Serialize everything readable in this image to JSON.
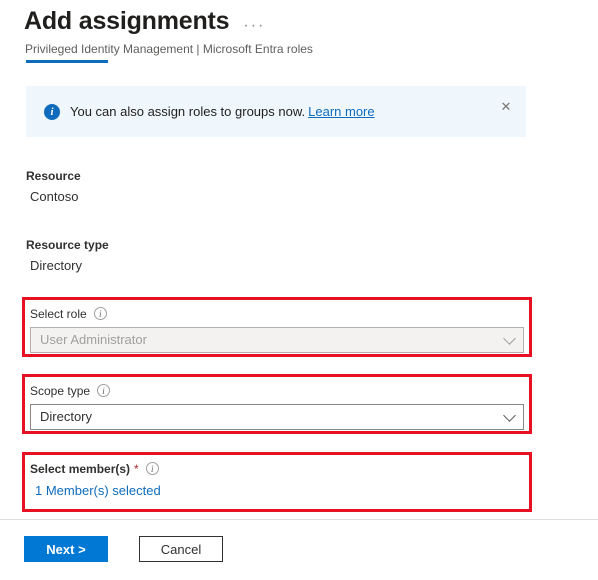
{
  "header": {
    "title": "Add assignments",
    "more_label": "···",
    "subtitle": "Privileged Identity Management | Microsoft Entra roles"
  },
  "banner": {
    "icon": "info-icon",
    "message": "You can also assign roles to groups now.",
    "link_label": "Learn more",
    "close_label": "✕",
    "background_color": "#EFF6FC",
    "accent_color": "#0F6CBD"
  },
  "resource": {
    "label": "Resource",
    "value": "Contoso"
  },
  "resource_type": {
    "label": "Resource type",
    "value": "Directory"
  },
  "select_role": {
    "label": "Select role",
    "hint_icon": "info-circle-icon",
    "value": "User Administrator",
    "disabled": true,
    "chevron_icon": "chevron-down-icon",
    "highlighted": true
  },
  "scope_type": {
    "label": "Scope type",
    "hint_icon": "info-circle-icon",
    "value": "Directory",
    "disabled": false,
    "chevron_icon": "chevron-down-icon",
    "highlighted": true
  },
  "select_members": {
    "label": "Select member(s)",
    "required_marker": "*",
    "hint_icon": "info-circle-icon",
    "link_label": "1 Member(s) selected",
    "highlighted": true
  },
  "footer": {
    "next_label": "Next >",
    "cancel_label": "Cancel",
    "primary_color": "#0078D4"
  },
  "highlight": {
    "color": "#E81123"
  }
}
